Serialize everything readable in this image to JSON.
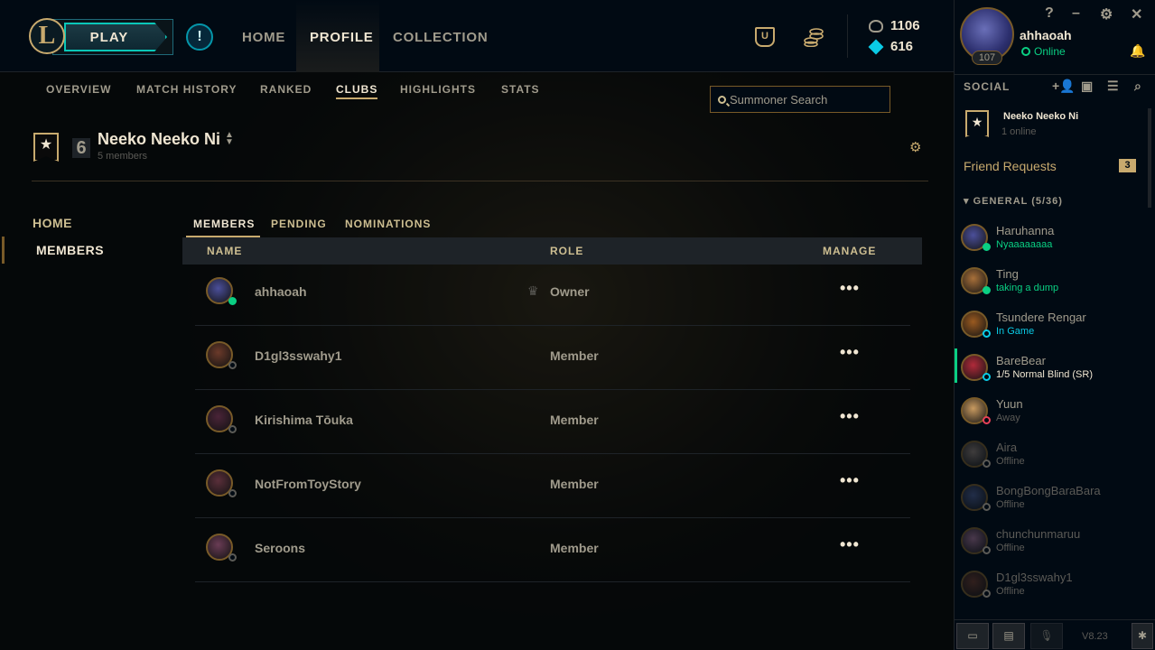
{
  "topnav": {
    "play_label": "PLAY",
    "logo_letter": "L",
    "alert_symbol": "!",
    "items": [
      {
        "label": "HOME"
      },
      {
        "label": "PROFILE",
        "active": true
      },
      {
        "label": "COLLECTION"
      }
    ],
    "currency": {
      "rp": "1106",
      "blue_essence": "616"
    }
  },
  "subnav": {
    "items": [
      {
        "label": "OVERVIEW"
      },
      {
        "label": "MATCH HISTORY"
      },
      {
        "label": "RANKED"
      },
      {
        "label": "CLUBS",
        "active": true
      },
      {
        "label": "HIGHLIGHTS"
      },
      {
        "label": "STATS"
      }
    ],
    "search_placeholder": "Summoner Search"
  },
  "club": {
    "count": "6",
    "name": "Neeko Neeko Ni",
    "members_text": "5 members"
  },
  "leftnav": {
    "home": "HOME",
    "members": "MEMBERS"
  },
  "member_tabs": [
    "MEMBERS",
    "PENDING",
    "NOMINATIONS"
  ],
  "table": {
    "headers": {
      "name": "NAME",
      "role": "ROLE",
      "manage": "MANAGE"
    },
    "rows": [
      {
        "name": "ahhaoah",
        "role": "Owner",
        "online": true,
        "avatar_color": "#4b4f9a"
      },
      {
        "name": "D1gl3sswahy1",
        "role": "Member",
        "online": false,
        "avatar_color": "#6b3a2a"
      },
      {
        "name": "Kirishima Tōuka",
        "role": "Member",
        "online": false,
        "avatar_color": "#4a2438"
      },
      {
        "name": "NotFromToyStory",
        "role": "Member",
        "online": false,
        "avatar_color": "#5a2f3a"
      },
      {
        "name": "Seroons",
        "role": "Member",
        "online": false,
        "avatar_color": "#6a3c55"
      }
    ],
    "manage_symbol": "•••"
  },
  "social": {
    "me": {
      "name": "ahhaoah",
      "status": "Online",
      "level": "107"
    },
    "window_controls": [
      "?",
      "–",
      "⚙",
      "✕"
    ],
    "title": "SOCIAL",
    "club": {
      "name": "Neeko Neeko Ni",
      "sub": "1 online"
    },
    "friend_requests": {
      "label": "Friend Requests",
      "count": "3"
    },
    "group": "GENERAL (5/36)",
    "friends": [
      {
        "name": "Haruhanna",
        "status": "Nyaaaaaaaa",
        "state": "online",
        "avatar_color": "#4b4f9a"
      },
      {
        "name": "Ting",
        "status": "taking a dump",
        "state": "online",
        "avatar_color": "#a8703a"
      },
      {
        "name": "Tsundere Rengar",
        "status": "In Game",
        "state": "ingame",
        "avatar_color": "#9a5a20"
      },
      {
        "name": "BareBear",
        "status": "1/5 Normal Blind (SR)",
        "state": "lobby",
        "avatar_color": "#b02a3a"
      },
      {
        "name": "Yuun",
        "status": "Away",
        "state": "away",
        "avatar_color": "#c89a60"
      },
      {
        "name": "Aira",
        "status": "Offline",
        "state": "offline",
        "avatar_color": "#8a7a70"
      },
      {
        "name": "BongBongBaraBara",
        "status": "Offline",
        "state": "offline",
        "avatar_color": "#4a5a8a"
      },
      {
        "name": "chunchunmaruu",
        "status": "Offline",
        "state": "offline",
        "avatar_color": "#a07090"
      },
      {
        "name": "D1gl3sswahy1",
        "status": "Offline",
        "state": "offline",
        "avatar_color": "#6b3a2a"
      }
    ],
    "version": "V8.23"
  },
  "colors": {
    "gold": "#c8aa6e",
    "online": "#0acf83",
    "ingame": "#0acbe6",
    "away": "#e84057",
    "offline": "#5b5a56"
  }
}
